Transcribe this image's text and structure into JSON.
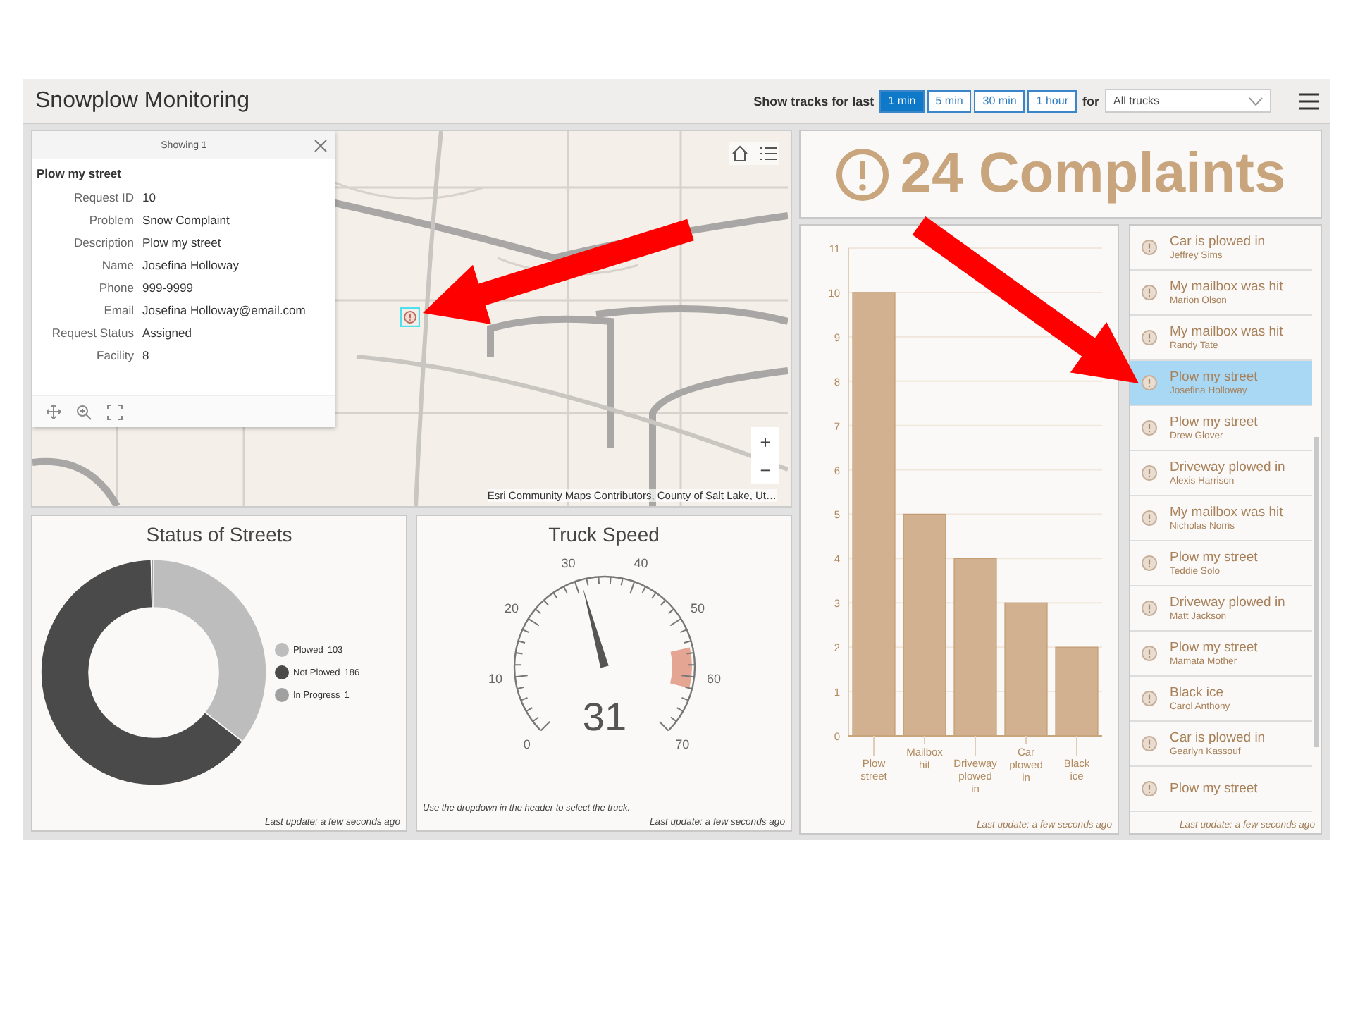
{
  "header": {
    "title": "Snowplow Monitoring",
    "tracks_label": "Show tracks for last",
    "ranges": [
      {
        "label": "1 min",
        "selected": true
      },
      {
        "label": "5 min",
        "selected": false
      },
      {
        "label": "30 min",
        "selected": false
      },
      {
        "label": "1 hour",
        "selected": false
      }
    ],
    "for_label": "for",
    "truck_select": {
      "value": "All trucks"
    }
  },
  "map": {
    "popup": {
      "header": "Showing 1",
      "title": "Plow my street",
      "fields": [
        {
          "label": "Request ID",
          "value": "10"
        },
        {
          "label": "Problem",
          "value": "Snow Complaint"
        },
        {
          "label": "Description",
          "value": "Plow my street"
        },
        {
          "label": "Name",
          "value": "Josefina Holloway"
        },
        {
          "label": "Phone",
          "value": "999-9999"
        },
        {
          "label": "Email",
          "value": "Josefina Holloway@email.com"
        },
        {
          "label": "Request Status",
          "value": "Assigned"
        },
        {
          "label": "Facility",
          "value": "8"
        }
      ]
    },
    "zoom_in": "+",
    "zoom_out": "−",
    "attribution": "Esri Community Maps Contributors, County of Salt Lake, Ut…"
  },
  "status_of_streets": {
    "chart_data": {
      "type": "donut",
      "title": "Status of Streets",
      "categories": [
        "Plowed",
        "Not Plowed",
        "In Progress"
      ],
      "values": [
        103,
        186,
        1
      ],
      "value_labels": [
        "103",
        "186",
        "1"
      ],
      "legend": "right"
    },
    "footer": "Last update: a few seconds ago"
  },
  "truck_speed": {
    "title": "Truck Speed",
    "scale_labels": [
      "0",
      "10",
      "20",
      "30",
      "40",
      "50",
      "60",
      "70"
    ],
    "level": 0.443,
    "reading": "31",
    "note": "Use the dropdown in the header to select the truck.",
    "footer": "Last update: a few seconds ago"
  },
  "complaints_indicator": {
    "value": "24 Complaints"
  },
  "complaints_by_type": {
    "chart_data": {
      "type": "bar",
      "categories": [
        "Plow street",
        "Mailbox hit",
        "Driveway plowed in",
        "Car plowed in",
        "Black ice"
      ],
      "values": [
        10,
        5,
        4,
        3,
        2
      ],
      "grid": true,
      "ylim": [
        0,
        11
      ],
      "yticks": [
        0,
        1,
        2,
        3,
        4,
        5,
        6,
        7,
        8,
        9,
        10,
        11
      ]
    },
    "footer": "Last update: a few seconds ago"
  },
  "complaints_list": {
    "items": [
      {
        "title": "Car is plowed in",
        "name": "Jeffrey Sims",
        "selected": false
      },
      {
        "title": "My mailbox was hit",
        "name": "Marion Olson",
        "selected": false
      },
      {
        "title": "My mailbox was hit",
        "name": "Randy Tate",
        "selected": false
      },
      {
        "title": "Plow my street",
        "name": "Josefina Holloway",
        "selected": true
      },
      {
        "title": "Plow my street",
        "name": "Drew Glover",
        "selected": false
      },
      {
        "title": "Driveway plowed in",
        "name": "Alexis Harrison",
        "selected": false
      },
      {
        "title": "My mailbox was hit",
        "name": "Nicholas Norris",
        "selected": false
      },
      {
        "title": "Plow my street",
        "name": "Teddie Solo",
        "selected": false
      },
      {
        "title": "Driveway plowed in",
        "name": "Matt Jackson",
        "selected": false
      },
      {
        "title": "Plow my street",
        "name": "Mamata Mother",
        "selected": false
      },
      {
        "title": "Black ice",
        "name": "Carol Anthony",
        "selected": false
      },
      {
        "title": "Car is plowed in",
        "name": "Gearlyn Kassouf",
        "selected": false
      },
      {
        "title": "Plow my street",
        "selected": false
      }
    ],
    "footer": "Last update: a few seconds ago"
  }
}
